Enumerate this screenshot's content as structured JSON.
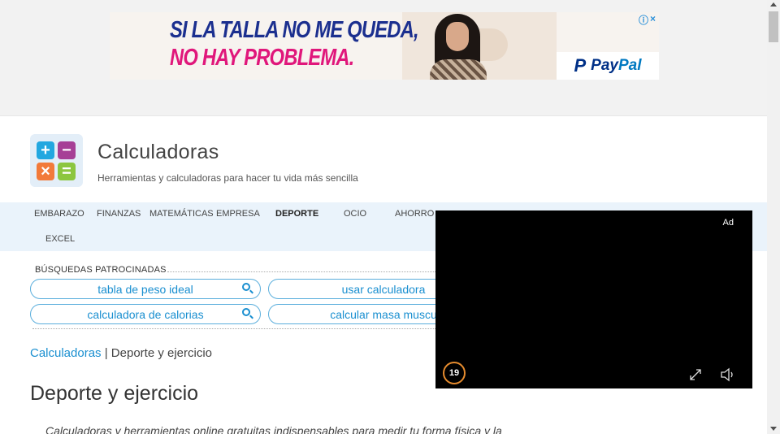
{
  "ad_banner": {
    "headline_line1": "SI LA TALLA NO ME QUEDA,",
    "headline_line2": "NO HAY PROBLEMA.",
    "brand": "PayPal",
    "brand_part1": "Pay",
    "brand_part2": "Pal",
    "adchoices_icon": "info-icon",
    "close_symbol": "×"
  },
  "header": {
    "title": "Calculadoras",
    "subtitle": "Herramientas y calculadoras para hacer tu vida más sencilla",
    "logo_symbols": [
      "+",
      "−",
      "×",
      "="
    ]
  },
  "nav": {
    "items": [
      {
        "label": "EMBARAZO"
      },
      {
        "label": "FINANZAS"
      },
      {
        "label": "MATEMÁTICAS"
      },
      {
        "label": "EMPRESA"
      },
      {
        "label": "DEPORTE"
      },
      {
        "label": "OCIO"
      },
      {
        "label": "AHORRO"
      },
      {
        "label": "EXCEL"
      }
    ],
    "active": "DEPORTE"
  },
  "sponsored": {
    "label": "BÚSQUEDAS PATROCINADAS",
    "searches": [
      "tabla de peso ideal",
      "usar calculadora",
      "calculadora de calorias",
      "calcular masa muscu"
    ]
  },
  "breadcrumb": {
    "root": "Calculadoras",
    "separator": "|",
    "current": "Deporte y ejercicio"
  },
  "page": {
    "title": "Deporte y ejercicio",
    "intro": "Calculadoras y herramientas online gratuitas indispensables para medir tu forma física y la"
  },
  "video_ad": {
    "tag": "Ad",
    "countdown": "19",
    "countdown_color": "#e58b2e"
  },
  "colors": {
    "accent": "#1a8fd0",
    "nav_bg": "#eaf3fb"
  }
}
